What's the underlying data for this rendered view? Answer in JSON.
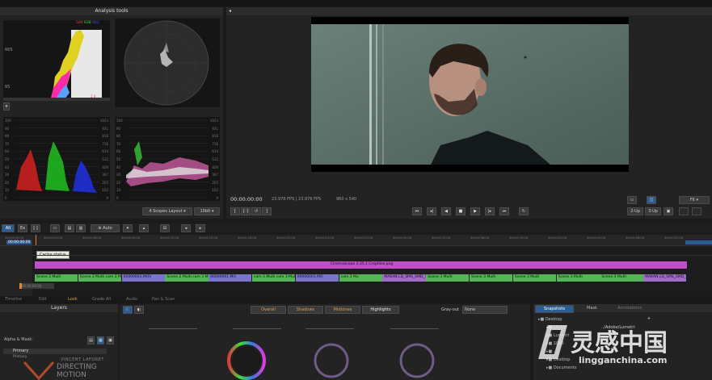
{
  "analysis": {
    "title": "Analysis tools",
    "hist_labels": [
      "589",
      "638",
      "663"
    ],
    "hist_left_ticks": [
      "665",
      "65"
    ],
    "parade_left": [
      "100",
      "90",
      "80",
      "70",
      "60",
      "50",
      "40",
      "30",
      "20",
      "10",
      "0"
    ],
    "parade_right": [
      "1023",
      "921",
      "818",
      "716",
      "614",
      "512",
      "409",
      "307",
      "205",
      "102",
      "0"
    ],
    "layout_select": "4 Scopes Layout",
    "bit_select": "10bit"
  },
  "viewer": {
    "timecode": "00:00:00:00",
    "fps": "23.976 FPS | 23.976 FPS",
    "resolution": "960 x 540",
    "fit_select": "Fit",
    "view_buttons": [
      "2-Up",
      "3-Up"
    ]
  },
  "timeline": {
    "all_button": "All",
    "auto_label": "Auto",
    "tooltip": "Cache status",
    "timecode_left": "00:00:00:00",
    "ruler": [
      "00:00:00:00",
      "00:00:03:00",
      "00:00:06:00",
      "00:00:09:00",
      "00:00:12:00",
      "00:00:15:00",
      "00:00:18:00",
      "00:00:21:00",
      "00:00:24:00",
      "00:00:27:00",
      "00:00:30:00",
      "00:00:33:00",
      "00:00:36:00",
      "00:00:39:00",
      "00:00:42:00",
      "00:00:45:00",
      "00:00:48:00",
      "00:00:51:00"
    ],
    "pink_clip": "Cinemascope 2.35.1 Croptiles.png",
    "clips": [
      {
        "label": "Scene 3 Multi",
        "color": "#55b455"
      },
      {
        "label": "Scene 2 Multi cam 2 Multi cam 3 Multi",
        "color": "#55b455"
      },
      {
        "label": "00000001.MOV",
        "color": "#7a74cc"
      },
      {
        "label": "Scene 2 Multi cam 3 Mu",
        "color": "#55b455"
      },
      {
        "label": "00000001.MO",
        "color": "#7a74cc"
      },
      {
        "label": "cam 3 Multi cam 3 Multi",
        "color": "#55b455"
      },
      {
        "label": "00000001.MO",
        "color": "#7a74cc"
      },
      {
        "label": "cam 3 Mu",
        "color": "#55b455"
      },
      {
        "label": "MAKAN LD_SMS_SMD_T1C1.MOV",
        "color": "#a06cc8"
      },
      {
        "label": "Scene 3 Multi",
        "color": "#55b455"
      },
      {
        "label": "Scene 3 Multi",
        "color": "#55b455"
      },
      {
        "label": "Scene 3 Multi",
        "color": "#55b455"
      },
      {
        "label": "Scene 3 Multi",
        "color": "#55b455"
      },
      {
        "label": "Scene 3 Multi",
        "color": "#55b455"
      },
      {
        "label": "MAKAN LD_SMS_SMD_T1C1.MOV",
        "color": "#a06cc8"
      }
    ]
  },
  "tabs": [
    "Timeline",
    "Edit",
    "Look",
    "Grade All",
    "Audio",
    "Pan & Scan"
  ],
  "layers": {
    "title": "Layers",
    "alpha_label": "Alpha & Mask:",
    "primary_label": "Primary",
    "primary_sub": "Primary",
    "logo_line1": "VINCENT LAFORET",
    "logo_line2": "DIRECTING",
    "logo_line3": "MOTION"
  },
  "grade": {
    "range_buttons": [
      "Overall",
      "Shadows",
      "Midtones",
      "Highlights"
    ],
    "grayout_label": "Gray-out",
    "grayout_value": "None"
  },
  "snapshots": {
    "tabs": [
      "Snapshots",
      "Mask",
      "Annotations"
    ],
    "path": "../Adobe/Lumetri",
    "folders": [
      "Desktop",
      "LS_01",
      "Lumetri",
      "1080",
      "...",
      "Desktop",
      "Documents"
    ]
  },
  "watermark": {
    "main": "灵感中国",
    "url": "lingganchina.com"
  }
}
